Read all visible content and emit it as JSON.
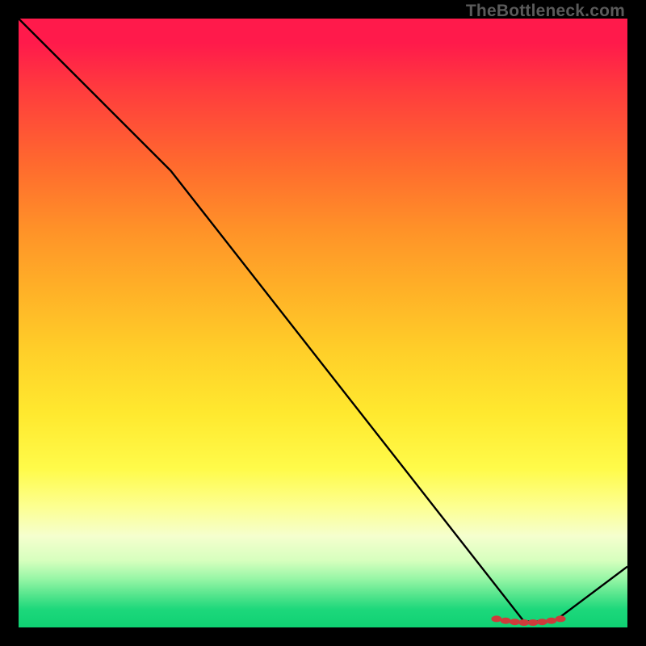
{
  "watermark": "TheBottleneck.com",
  "chart_data": {
    "type": "line",
    "title": "",
    "xlabel": "",
    "ylabel": "",
    "xlim": [
      0,
      100
    ],
    "ylim": [
      0,
      100
    ],
    "grid": false,
    "legend": false,
    "series": [
      {
        "name": "curve",
        "color": "#000000",
        "x": [
          0,
          25,
          83,
          88,
          100
        ],
        "y": [
          100,
          75,
          1,
          1,
          10
        ]
      }
    ],
    "markers": {
      "name": "cluster",
      "color": "#cf3b3b",
      "points": [
        {
          "x": 78.5,
          "y": 1.4
        },
        {
          "x": 80.0,
          "y": 1.1
        },
        {
          "x": 81.5,
          "y": 0.9
        },
        {
          "x": 83.0,
          "y": 0.8
        },
        {
          "x": 84.5,
          "y": 0.8
        },
        {
          "x": 86.0,
          "y": 0.9
        },
        {
          "x": 87.5,
          "y": 1.1
        },
        {
          "x": 89.0,
          "y": 1.4
        }
      ]
    }
  }
}
